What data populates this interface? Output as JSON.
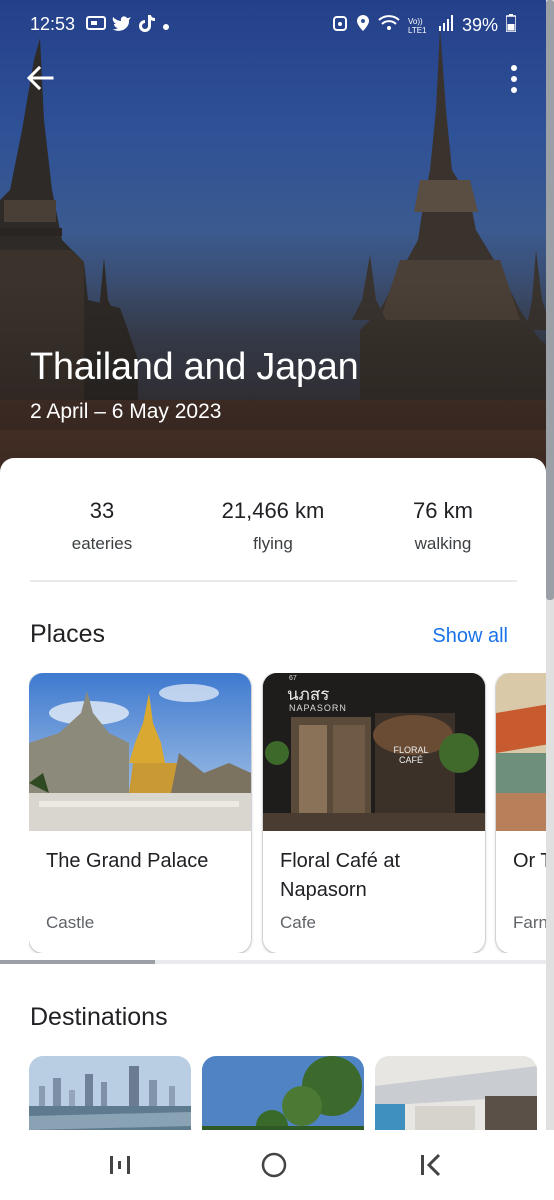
{
  "status_bar": {
    "time": "12:53",
    "left_icons": [
      "message-icon",
      "twitter-icon",
      "tiktok-icon",
      "dot-icon"
    ],
    "right_icons": [
      "alarm-icon",
      "location-icon",
      "wifi-icon",
      "volte-icon",
      "signal-icon",
      "battery-icon"
    ],
    "volte_label": "Vo)) LTE1",
    "battery": "39%"
  },
  "hero": {
    "title": "Thailand and Japan",
    "dates": "2 April – 6 May 2023"
  },
  "stats": [
    {
      "value": "33",
      "label": "eateries"
    },
    {
      "value": "21,466 km",
      "label": "flying"
    },
    {
      "value": "76 km",
      "label": "walking"
    }
  ],
  "places": {
    "title": "Places",
    "show_all": "Show all",
    "cards": [
      {
        "name": "The Grand Palace",
        "type": "Castle",
        "image": "temple-photo"
      },
      {
        "name": "Floral Café at Napasorn",
        "type": "Cafe",
        "image": "cafe-photo",
        "sign_text_thai": "นภสร",
        "sign_text": "NAPASORN",
        "sign_number": "67",
        "window_text": "FLORAL CAFÉ"
      },
      {
        "name": "Or T",
        "type": "Farn",
        "image": "market-photo"
      }
    ]
  },
  "destinations": {
    "title": "Destinations",
    "cards": [
      "city-skyline-photo",
      "beach-photo",
      "street-photo"
    ]
  },
  "nav": {
    "recents": "recents-icon",
    "home": "home-icon",
    "back": "back-icon"
  },
  "colors": {
    "accent": "#1a73e8",
    "hero_sky": "#2f5196"
  }
}
